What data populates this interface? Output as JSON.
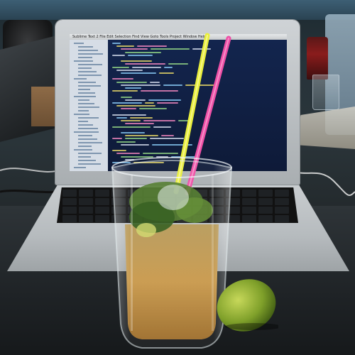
{
  "scene": {
    "objects": [
      {
        "name": "laptop",
        "label": "laptop with code editor"
      },
      {
        "name": "drink-glass",
        "label": "iced mojito-style drink"
      },
      {
        "name": "straws",
        "label": "yellow and pink straws"
      },
      {
        "name": "lime",
        "label": "lime"
      }
    ]
  },
  "screen": {
    "menubar": [
      "Sublime Text 2",
      "File",
      "Edit",
      "Selection",
      "Find",
      "View",
      "Goto",
      "Tools",
      "Project",
      "Window",
      "Help"
    ]
  },
  "colors": {
    "straw_yellow": "#e8ee3b",
    "straw_pink": "#ee4fa6",
    "drink_amber": "#c8984a",
    "lime_green": "#7fa02a",
    "screen_bg": "#0f1d3a"
  }
}
